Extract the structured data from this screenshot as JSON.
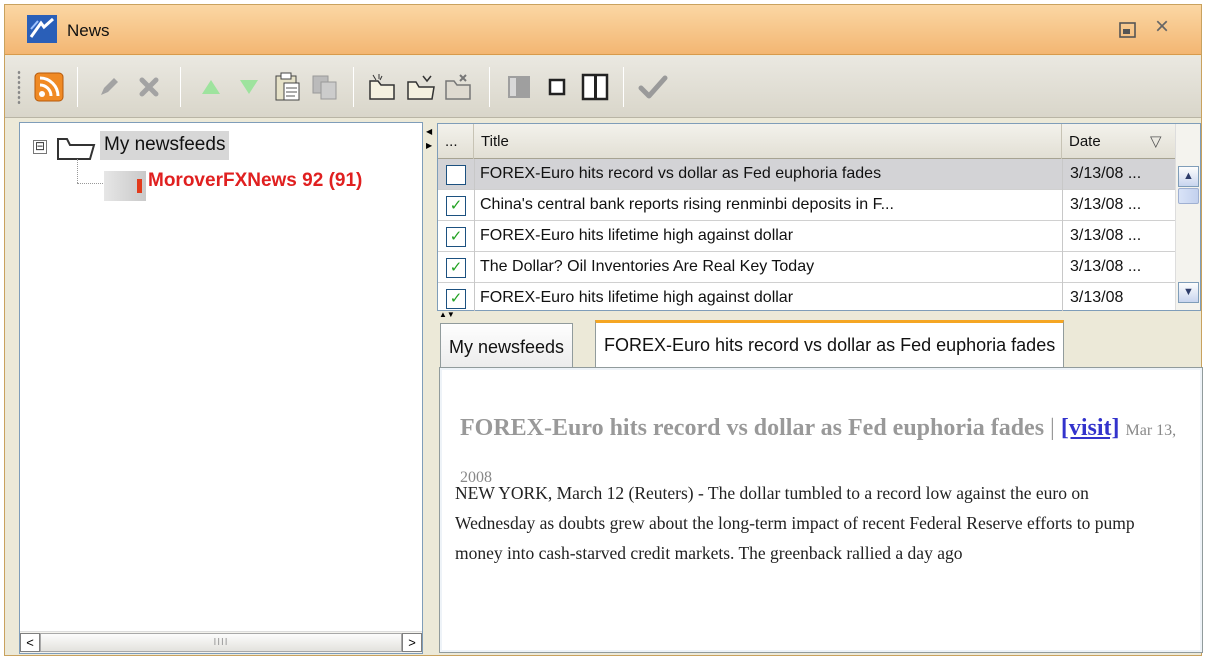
{
  "window": {
    "title": "News"
  },
  "toolbar": {
    "buttons": [
      {
        "name": "rss-icon"
      },
      {
        "name": "edit-icon"
      },
      {
        "name": "delete-icon"
      },
      {
        "name": "move-up-icon"
      },
      {
        "name": "move-down-icon"
      },
      {
        "name": "paste-icon"
      },
      {
        "name": "copy-icon"
      },
      {
        "name": "new-folder-icon"
      },
      {
        "name": "open-folder-icon"
      },
      {
        "name": "folder-settings-icon"
      },
      {
        "name": "layout-left-icon"
      },
      {
        "name": "layout-single-icon"
      },
      {
        "name": "layout-split-icon"
      },
      {
        "name": "mark-read-icon"
      }
    ]
  },
  "tree": {
    "root_label": "My newsfeeds",
    "expander": "⊟",
    "feed_label": "MoroverFXNews 92 (91)"
  },
  "list": {
    "columns": {
      "marker": "...",
      "title": "Title",
      "date": "Date"
    },
    "sort_glyph": "▽",
    "rows": [
      {
        "checked": false,
        "title": "FOREX-Euro hits record vs dollar as Fed euphoria fades",
        "date": "3/13/08 ..."
      },
      {
        "checked": true,
        "title": "China's central bank reports rising renminbi deposits in F...",
        "date": "3/13/08 ..."
      },
      {
        "checked": true,
        "title": "FOREX-Euro hits lifetime high against dollar",
        "date": "3/13/08 ..."
      },
      {
        "checked": true,
        "title": "The Dollar? Oil Inventories Are Real Key Today",
        "date": "3/13/08 ..."
      },
      {
        "checked": true,
        "title": "FOREX-Euro hits lifetime high against dollar",
        "date": "3/13/08"
      }
    ]
  },
  "tabs": [
    {
      "label": "My newsfeeds"
    },
    {
      "label": "FOREX-Euro hits record vs dollar as Fed euphoria fades"
    }
  ],
  "article": {
    "title": "FOREX-Euro hits record vs dollar as Fed euphoria fades",
    "separator": "|",
    "visit_label": "[visit]",
    "date": "Mar 13, 2008",
    "body": "NEW YORK, March 12 (Reuters) - The dollar tumbled to a record low against the euro on Wednesday as doubts grew about the long-term impact of recent Federal Reserve efforts to pump money into cash-starved credit markets. The greenback rallied a day ago"
  },
  "colors": {
    "title_bar": "#f3b673",
    "feed_label": "#e02020",
    "active_tab_accent": "#f5a623",
    "checkbox_check": "#21a121",
    "link": "#3333cc"
  }
}
